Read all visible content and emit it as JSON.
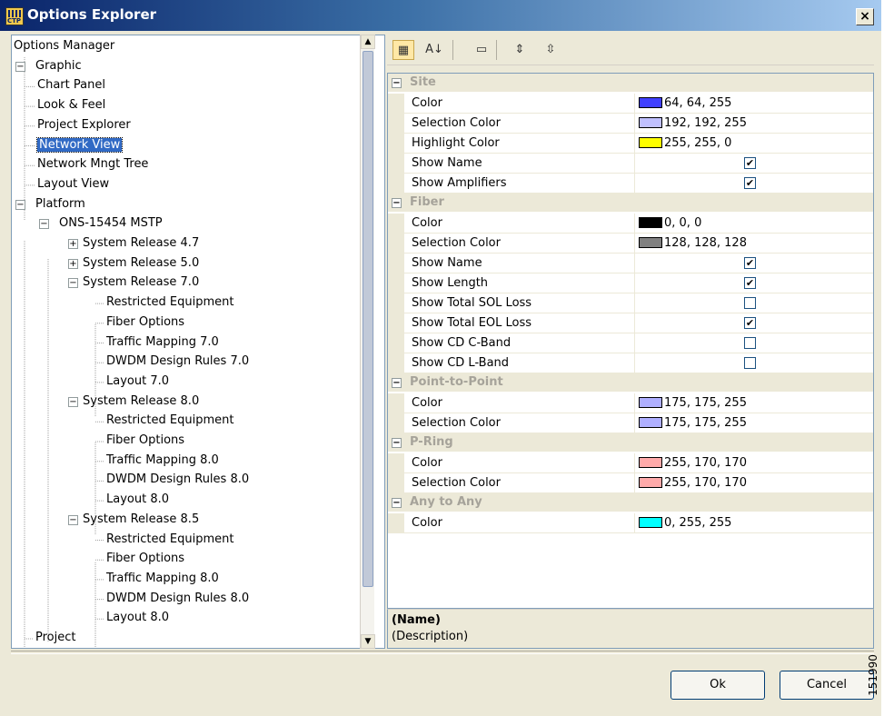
{
  "window": {
    "title": "Options Explorer",
    "logo_text": "CTP",
    "close_glyph": "×"
  },
  "tree": {
    "items": [
      {
        "label": "Options Manager",
        "level": 0,
        "expander": ""
      },
      {
        "label": "Graphic",
        "level": 0,
        "expander": "−"
      },
      {
        "label": "Chart Panel",
        "level": 1,
        "expander": ""
      },
      {
        "label": "Look & Feel",
        "level": 1,
        "expander": ""
      },
      {
        "label": "Project Explorer",
        "level": 1,
        "expander": ""
      },
      {
        "label": "Network View",
        "level": 1,
        "expander": "",
        "selected": true
      },
      {
        "label": "Network Mngt Tree",
        "level": 1,
        "expander": ""
      },
      {
        "label": "Layout View",
        "level": 1,
        "expander": ""
      },
      {
        "label": "Platform",
        "level": 0,
        "expander": "−"
      },
      {
        "label": "ONS-15454 MSTP",
        "level": 1,
        "expander": "−"
      },
      {
        "label": "System Release 4.7",
        "level": 2,
        "expander": "+"
      },
      {
        "label": "System Release 5.0",
        "level": 2,
        "expander": "+"
      },
      {
        "label": "System Release 7.0",
        "level": 2,
        "expander": "−"
      },
      {
        "label": "Restricted Equipment",
        "level": 3,
        "expander": ""
      },
      {
        "label": "Fiber Options",
        "level": 3,
        "expander": ""
      },
      {
        "label": "Traffic Mapping 7.0",
        "level": 3,
        "expander": ""
      },
      {
        "label": "DWDM Design Rules 7.0",
        "level": 3,
        "expander": ""
      },
      {
        "label": "Layout 7.0",
        "level": 3,
        "expander": ""
      },
      {
        "label": "System Release 8.0",
        "level": 2,
        "expander": "−"
      },
      {
        "label": "Restricted Equipment",
        "level": 3,
        "expander": ""
      },
      {
        "label": "Fiber Options",
        "level": 3,
        "expander": ""
      },
      {
        "label": "Traffic Mapping 8.0",
        "level": 3,
        "expander": ""
      },
      {
        "label": "DWDM Design Rules 8.0",
        "level": 3,
        "expander": ""
      },
      {
        "label": "Layout 8.0",
        "level": 3,
        "expander": ""
      },
      {
        "label": "System Release 8.5",
        "level": 2,
        "expander": "−"
      },
      {
        "label": "Restricted Equipment",
        "level": 3,
        "expander": ""
      },
      {
        "label": "Fiber Options",
        "level": 3,
        "expander": ""
      },
      {
        "label": "Traffic Mapping 8.0",
        "level": 3,
        "expander": ""
      },
      {
        "label": "DWDM Design Rules 8.0",
        "level": 3,
        "expander": ""
      },
      {
        "label": "Layout 8.0",
        "level": 3,
        "expander": ""
      },
      {
        "label": "Project",
        "level": 0,
        "expander": ""
      }
    ]
  },
  "toolbar": {
    "buttons": [
      {
        "icon": "categorized-icon",
        "glyph": "▦",
        "active": true
      },
      {
        "icon": "sort-alphabetical-icon",
        "glyph": "A↓",
        "active": false
      },
      {
        "icon": "property-pages-icon",
        "glyph": "▭",
        "active": false
      },
      {
        "icon": "expand-all-icon",
        "glyph": "⇕",
        "active": false
      },
      {
        "icon": "collapse-all-icon",
        "glyph": "⇳",
        "active": false
      }
    ]
  },
  "properties": {
    "categories": [
      {
        "name": "Site",
        "props": [
          {
            "name": "Color",
            "type": "color",
            "swatch": "#4040ff",
            "value": "64, 64, 255"
          },
          {
            "name": "Selection Color",
            "type": "color",
            "swatch": "#c0c0ff",
            "value": "192, 192, 255"
          },
          {
            "name": "Highlight Color",
            "type": "color",
            "swatch": "#ffff00",
            "value": "255, 255, 0"
          },
          {
            "name": "Show Name",
            "type": "bool",
            "checked": true
          },
          {
            "name": "Show Amplifiers",
            "type": "bool",
            "checked": true
          }
        ]
      },
      {
        "name": "Fiber",
        "props": [
          {
            "name": "Color",
            "type": "color",
            "swatch": "#000000",
            "value": "0, 0, 0"
          },
          {
            "name": "Selection Color",
            "type": "color",
            "swatch": "#808080",
            "value": "128, 128, 128"
          },
          {
            "name": "Show Name",
            "type": "bool",
            "checked": true
          },
          {
            "name": "Show Length",
            "type": "bool",
            "checked": true
          },
          {
            "name": "Show Total SOL Loss",
            "type": "bool",
            "checked": false
          },
          {
            "name": "Show Total EOL Loss",
            "type": "bool",
            "checked": true
          },
          {
            "name": "Show CD C-Band",
            "type": "bool",
            "checked": false
          },
          {
            "name": "Show CD L-Band",
            "type": "bool",
            "checked": false
          }
        ]
      },
      {
        "name": "Point-to-Point",
        "props": [
          {
            "name": "Color",
            "type": "color",
            "swatch": "#afafff",
            "value": "175, 175, 255"
          },
          {
            "name": "Selection Color",
            "type": "color",
            "swatch": "#afafff",
            "value": "175, 175, 255"
          }
        ]
      },
      {
        "name": "P-Ring",
        "props": [
          {
            "name": "Color",
            "type": "color",
            "swatch": "#ffaaaa",
            "value": "255, 170, 170"
          },
          {
            "name": "Selection Color",
            "type": "color",
            "swatch": "#ffaaaa",
            "value": "255, 170, 170"
          }
        ]
      },
      {
        "name": "Any to Any",
        "props": [
          {
            "name": "Color",
            "type": "color",
            "swatch": "#00ffff",
            "value": "0, 255, 255"
          }
        ]
      }
    ]
  },
  "description": {
    "name": "(Name)",
    "text": "(Description)"
  },
  "buttons": {
    "ok": "Ok",
    "cancel": "Cancel"
  },
  "side_label": "151990"
}
